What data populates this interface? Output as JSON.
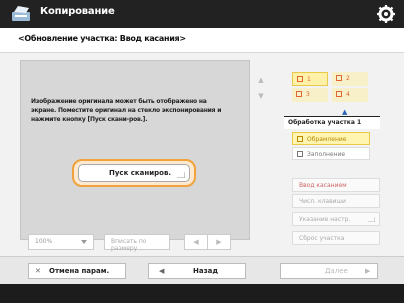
{
  "header": {
    "title": "Копирование",
    "settings_icon": "gear-icon"
  },
  "subtitle": "<Обновление участка: Ввод касания>",
  "preview": {
    "message": "Изображение оригинала может быть отображено на экране. Поместите оригинал на стекло экспонирования и нажмите кнопку [Пуск скани-ров.].",
    "scan_button_label": "Пуск сканиров."
  },
  "controls": {
    "zoom_value": "100%",
    "fit_button_label": "Вписать по размеру",
    "prev_arrow": "◀",
    "next_arrow": "▶",
    "scroll_up": "▲",
    "scroll_down": "▼"
  },
  "pages": [
    {
      "label": "1",
      "selected": true
    },
    {
      "label": "2",
      "selected": false
    },
    {
      "label": "3",
      "selected": false
    },
    {
      "label": "4",
      "selected": false
    }
  ],
  "sidebar": {
    "section_label": "Обработка участка 1",
    "options": [
      {
        "label": "Обрамление",
        "selected": true
      },
      {
        "label": "Заполнение",
        "selected": false
      }
    ],
    "buttons": [
      {
        "label": "Ввод касанием"
      },
      {
        "label": "Числ. клавиши"
      },
      {
        "label": "Указание настр."
      },
      {
        "label": "Сброс участка"
      }
    ]
  },
  "footer": {
    "cancel_label": "Отмена парам.",
    "back_label": "Назад",
    "next_label": "Далее"
  },
  "colors": {
    "accent": "#f0a23c",
    "title_bar": "#222222",
    "page_label": "#dd6633",
    "selected_fill": "#fff5b0"
  }
}
